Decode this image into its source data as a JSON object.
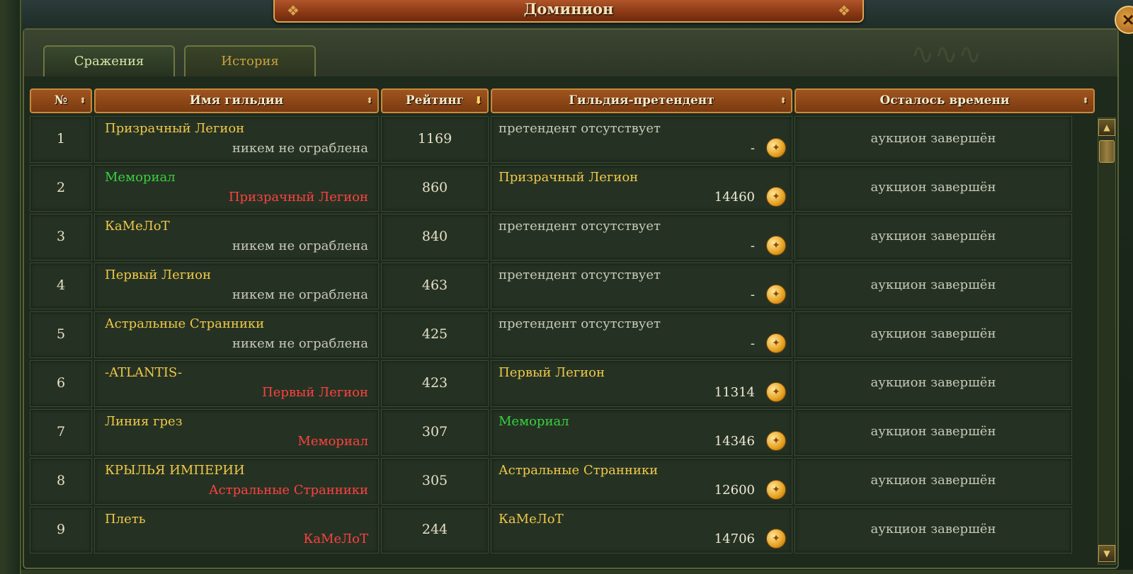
{
  "window": {
    "title": "Доминион",
    "close_glyph": "✕"
  },
  "tabs": [
    {
      "label": "Сражения",
      "active": true
    },
    {
      "label": "История",
      "active": false
    }
  ],
  "columns": {
    "num": "№",
    "guild": "Имя гильдии",
    "rating": "Рейтинг",
    "challenger": "Гильдия-претендент",
    "time": "Осталось времени"
  },
  "rows": [
    {
      "num": "1",
      "guild": "Призрачный Легион",
      "robbed_by": "никем не ограблена",
      "rating": "1169",
      "challenger": "претендент отсутствует",
      "bid": "-",
      "time": "аукцион завершён"
    },
    {
      "num": "2",
      "guild": "Мемориал",
      "robbed_by": "Призрачный Легион",
      "rating": "860",
      "challenger": "Призрачный Легион",
      "bid": "14460",
      "time": "аукцион завершён"
    },
    {
      "num": "3",
      "guild": "КаМеЛоТ",
      "robbed_by": "никем не ограблена",
      "rating": "840",
      "challenger": "претендент отсутствует",
      "bid": "-",
      "time": "аукцион завершён"
    },
    {
      "num": "4",
      "guild": "Первый Легион",
      "robbed_by": "никем не ограблена",
      "rating": "463",
      "challenger": "претендент отсутствует",
      "bid": "-",
      "time": "аукцион завершён"
    },
    {
      "num": "5",
      "guild": "Астральные Странники",
      "robbed_by": "никем не ограблена",
      "rating": "425",
      "challenger": "претендент отсутствует",
      "bid": "-",
      "time": "аукцион завершён"
    },
    {
      "num": "6",
      "guild": "-ATLANTIS-",
      "robbed_by": "Первый Легион",
      "rating": "423",
      "challenger": "Первый Легион",
      "bid": "11314",
      "time": "аукцион завершён"
    },
    {
      "num": "7",
      "guild": "Линия грез",
      "robbed_by": "Мемориал",
      "rating": "307",
      "challenger": "Мемориал",
      "bid": "14346",
      "time": "аукцион завершён"
    },
    {
      "num": "8",
      "guild": "КРЫЛЬЯ ИМПЕРИИ",
      "robbed_by": "Астральные Странники",
      "rating": "305",
      "challenger": "Астральные Странники",
      "bid": "12600",
      "time": "аукцион завершён"
    },
    {
      "num": "9",
      "guild": "Плеть",
      "robbed_by": "КаМеЛоТ",
      "rating": "244",
      "challenger": "КаМеЛоТ",
      "bid": "14706",
      "time": "аукцион завершён"
    }
  ],
  "colors": {
    "guild_yellow": "#f0c848",
    "guild_green": "#38d040",
    "robbed_red": "#ff4040",
    "neutral_text": "#c8c8b8",
    "header_brown": "#a0541e"
  },
  "icons": {
    "coin": "gold-coin-icon",
    "sort": "sort-arrows-icon",
    "sort_active": "sort-down-arrow-icon"
  }
}
